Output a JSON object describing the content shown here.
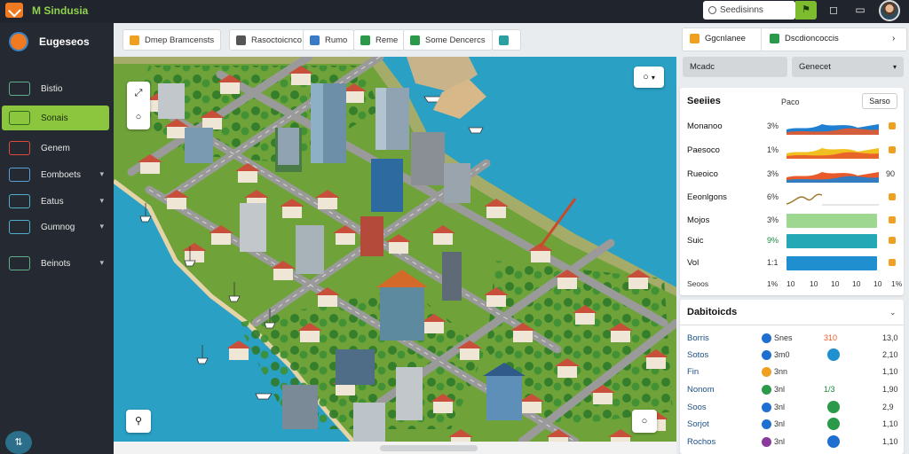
{
  "app": {
    "title": "M Sindusia"
  },
  "search": {
    "placeholder": "Seedisinns"
  },
  "sidebar": {
    "header": "Eugeseos",
    "items": [
      {
        "label": "Bistio",
        "active": false,
        "chevron": false,
        "color": "#5fb08a"
      },
      {
        "label": "Sonais",
        "active": true,
        "chevron": false,
        "color": "#2d6a1a"
      },
      {
        "label": "Genem",
        "active": false,
        "chevron": false,
        "color": "#e04a3a"
      },
      {
        "label": "Eomboets",
        "active": false,
        "chevron": true,
        "color": "#5aa0d8"
      },
      {
        "label": "Eatus",
        "active": false,
        "chevron": true,
        "color": "#4fb0c8"
      },
      {
        "label": "Gumnog",
        "active": false,
        "chevron": true,
        "color": "#4fb0c8"
      },
      {
        "label": "Beinots",
        "active": false,
        "chevron": true,
        "color": "#5fb08a"
      }
    ]
  },
  "toolbar": {
    "items": [
      {
        "label": "Dmep Bramcensts",
        "color": "#f0a020"
      },
      {
        "label": "Rasoctoicnco",
        "color": "#555555"
      },
      {
        "label": "Rumo",
        "color": "#3a7bc8"
      },
      {
        "label": "Reme",
        "color": "#2a9a4a"
      },
      {
        "label": "Some Dencercs",
        "color": "#2a9a4a"
      },
      {
        "label": "",
        "color": "#2aa0a0"
      }
    ]
  },
  "right_panel": {
    "tabs": [
      {
        "label": "Ggcnlanee",
        "color": "#f0a020"
      },
      {
        "label": "Dscdioncoccis",
        "color": "#2a9a4a"
      }
    ],
    "selects": [
      "Mcadc",
      "Genecet"
    ],
    "sections_card": {
      "title": "Seeiies",
      "subtitle": "Paco",
      "button": "Sarso",
      "rows": [
        {
          "label": "Monanoo",
          "pct": "3%",
          "end": "",
          "chart": "area-multi",
          "colors": [
            "#1f7fd0",
            "#e85a2a"
          ]
        },
        {
          "label": "Paesoco",
          "pct": "1%",
          "end": "",
          "chart": "area-multi",
          "colors": [
            "#f0c020",
            "#e85a2a"
          ]
        },
        {
          "label": "Rueoico",
          "pct": "3%",
          "end": "90",
          "chart": "area",
          "colors": [
            "#e85a2a",
            "#1f7fd0"
          ]
        },
        {
          "label": "Eeonlgons",
          "pct": "6%",
          "end": "",
          "chart": "line",
          "colors": [
            "#a07a30"
          ]
        },
        {
          "label": "Mojos",
          "pct": "3%",
          "end": "",
          "chart": "bar",
          "fill": 1.0,
          "colors": [
            "#9ed890"
          ]
        },
        {
          "label": "Suic",
          "pct": "9%",
          "end": "",
          "chart": "bar",
          "fill": 1.0,
          "colors": [
            "#25a8b5"
          ]
        },
        {
          "label": "Vol",
          "pct": "1:1",
          "end": "",
          "chart": "bar",
          "fill": 1.0,
          "colors": [
            "#1f8fd0"
          ]
        }
      ],
      "axis_label": "Seoos",
      "axis_ticks": [
        "1%",
        "10",
        "10",
        "10",
        "10",
        "10",
        "1%"
      ]
    },
    "list_card": {
      "title": "Dabitoicds",
      "rows": [
        {
          "name": "Borris",
          "dot": "#1f6fd0",
          "v1": "Snes",
          "v2": "310",
          "v2color": "#e85a2a",
          "glyph": "",
          "v3": "13,0"
        },
        {
          "name": "Sotos",
          "dot": "#1f6fd0",
          "v1": "3m0",
          "v2": "",
          "v2color": "",
          "glyph": "#1f8fd0",
          "v3": "2,10"
        },
        {
          "name": "Fin",
          "dot": "#f0a020",
          "v1": "3nn",
          "v2": "",
          "v2color": "",
          "glyph": "",
          "v3": "1,10"
        },
        {
          "name": "Nonom",
          "dot": "#2a9a4a",
          "v1": "3nl",
          "v2": "1/3",
          "v2color": "#1a8a3a",
          "glyph": "",
          "v3": "1,90"
        },
        {
          "name": "Soos",
          "dot": "#1f6fd0",
          "v1": "3nl",
          "v2": "",
          "v2color": "",
          "glyph": "#2a9a4a",
          "v3": "2,9"
        },
        {
          "name": "Sorjot",
          "dot": "#1f6fd0",
          "v1": "3nl",
          "v2": "",
          "v2color": "",
          "glyph": "#2a9a4a",
          "v3": "1,10"
        },
        {
          "name": "Rochos",
          "dot": "#8a3a9a",
          "v1": "3nl",
          "v2": "",
          "v2color": "",
          "glyph": "#1f6fd0",
          "v3": "1,10"
        }
      ]
    }
  },
  "map_controls": {
    "layer_button": "○",
    "zoom_in": "⤢",
    "zoom_out": "○",
    "bottom_left": "⚲",
    "bottom_right": "○"
  },
  "colors": {
    "accent": "#8cc63f",
    "sidebar_bg": "#252a32",
    "water": "#2aa1c4",
    "grass": "#6fa33a",
    "road": "#9a9a9a"
  }
}
